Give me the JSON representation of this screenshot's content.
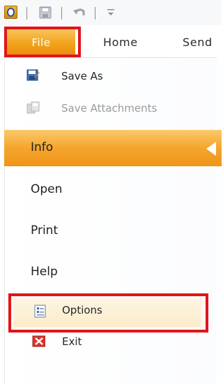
{
  "quick_access": {
    "app_icon": "outlook-icon",
    "save_icon": "save-icon",
    "undo_icon": "undo-icon",
    "customize_icon": "customize-dropdown-icon"
  },
  "tabs": {
    "file": "File",
    "home": "Home",
    "send": "Send"
  },
  "backstage": {
    "commands": [
      {
        "label": "Save As",
        "icon": "save-as-icon",
        "enabled": true
      },
      {
        "label": "Save Attachments",
        "icon": "save-attachments-icon",
        "enabled": false
      }
    ],
    "nav": [
      {
        "label": "Info",
        "selected": true
      },
      {
        "label": "Open"
      },
      {
        "label": "Print"
      },
      {
        "label": "Help"
      }
    ],
    "options": {
      "label": "Options",
      "icon": "options-icon",
      "highlighted": true
    },
    "exit": {
      "label": "Exit",
      "icon": "exit-icon"
    }
  },
  "colors": {
    "accent_orange": "#f5a52c",
    "highlight_red": "#e0151b"
  }
}
